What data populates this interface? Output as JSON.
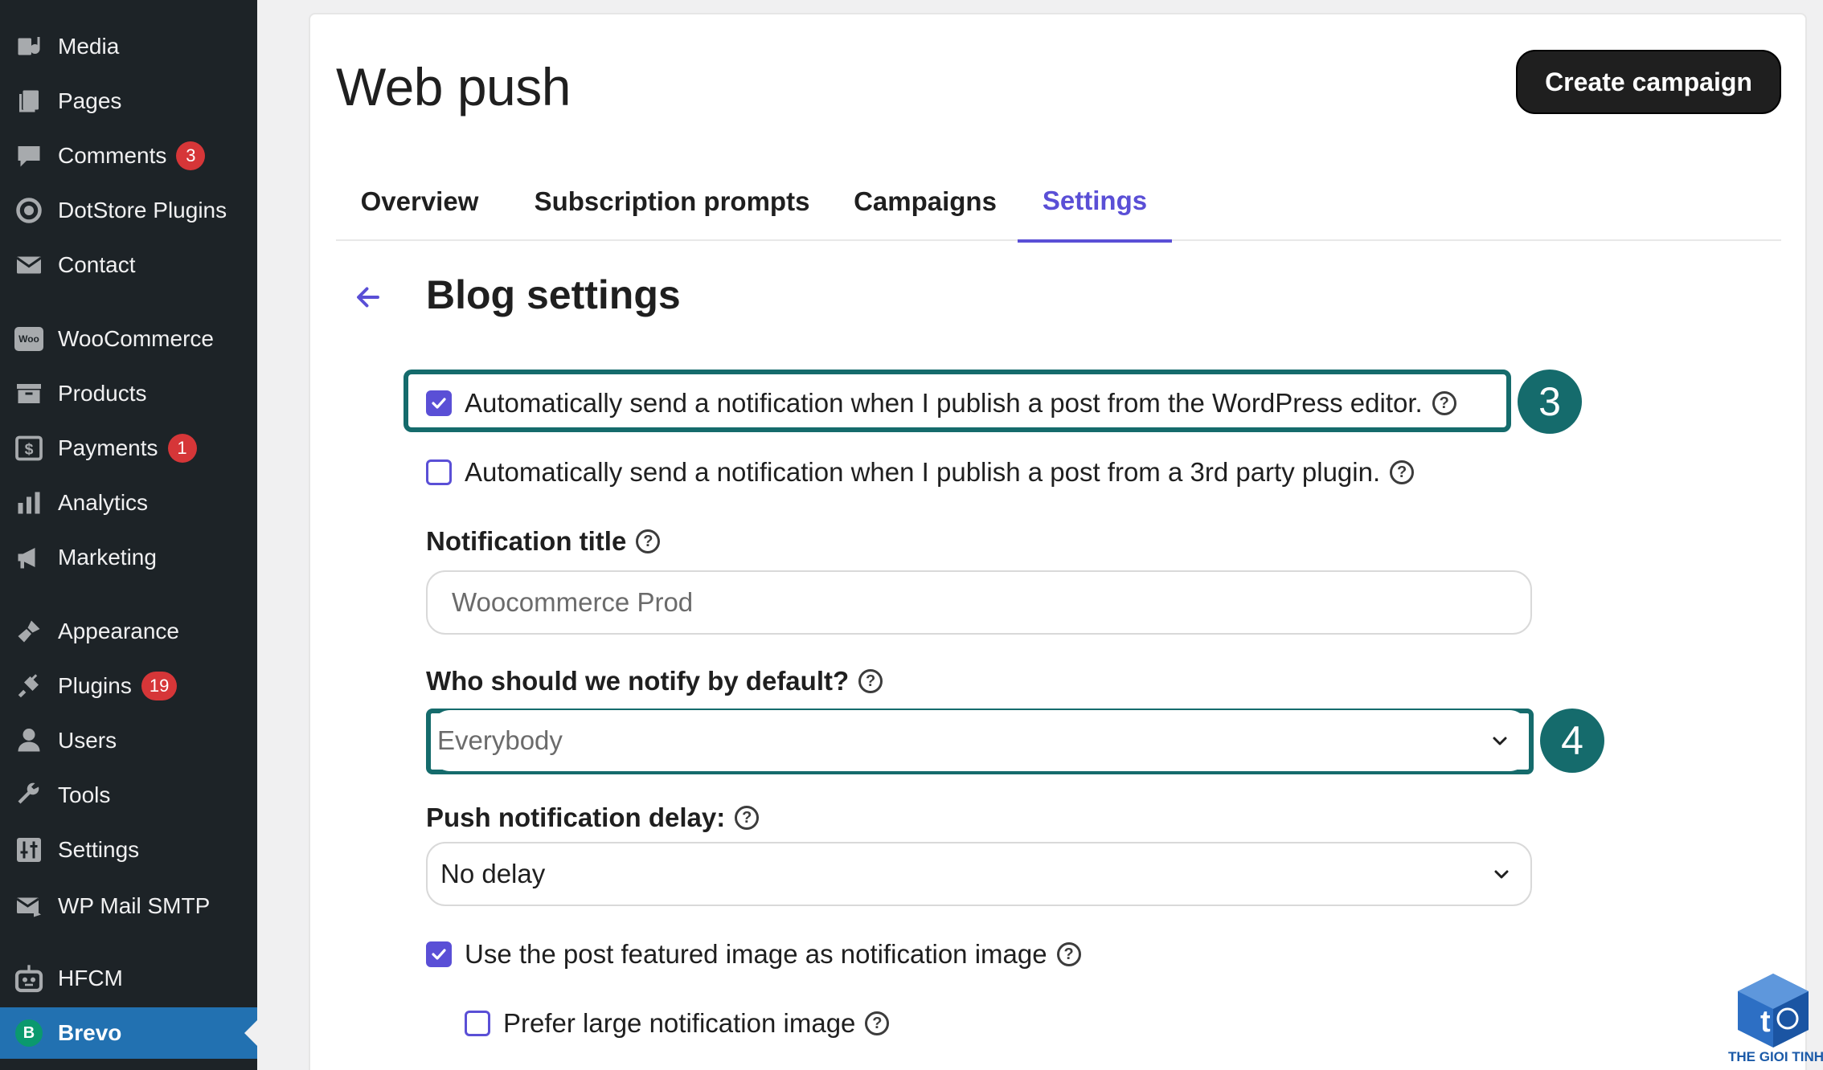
{
  "sidebar": {
    "items": [
      {
        "label": "Media",
        "icon": "media-icon"
      },
      {
        "label": "Pages",
        "icon": "pages-icon"
      },
      {
        "label": "Comments",
        "icon": "comments-icon",
        "badge": "3"
      },
      {
        "label": "DotStore Plugins",
        "icon": "dotstore-icon"
      },
      {
        "label": "Contact",
        "icon": "mail-icon"
      },
      {
        "label": "WooCommerce",
        "icon": "woocommerce-icon",
        "icon_text": "Woo"
      },
      {
        "label": "Products",
        "icon": "products-icon"
      },
      {
        "label": "Payments",
        "icon": "payments-icon",
        "badge": "1"
      },
      {
        "label": "Analytics",
        "icon": "analytics-icon"
      },
      {
        "label": "Marketing",
        "icon": "megaphone-icon"
      },
      {
        "label": "Appearance",
        "icon": "paintbrush-icon"
      },
      {
        "label": "Plugins",
        "icon": "plugin-icon",
        "badge": "19"
      },
      {
        "label": "Users",
        "icon": "users-icon"
      },
      {
        "label": "Tools",
        "icon": "wrench-icon"
      },
      {
        "label": "Settings",
        "icon": "settings-icon"
      },
      {
        "label": "WP Mail SMTP",
        "icon": "mail-smtp-icon"
      },
      {
        "label": "HFCM",
        "icon": "robot-icon"
      },
      {
        "label": "Brevo",
        "icon": "brevo-icon",
        "icon_text": "B",
        "active": true
      }
    ]
  },
  "header": {
    "title": "Web push",
    "create_button": "Create campaign"
  },
  "tabs": [
    {
      "label": "Overview"
    },
    {
      "label": "Subscription prompts"
    },
    {
      "label": "Campaigns"
    },
    {
      "label": "Settings",
      "active": true
    }
  ],
  "section": {
    "title": "Blog settings"
  },
  "options": {
    "auto_send_editor": {
      "label": "Automatically send a notification when I publish a post from the WordPress editor.",
      "checked": true,
      "step": "3"
    },
    "auto_send_plugin": {
      "label": "Automatically send a notification when I publish a post from a 3rd party plugin.",
      "checked": false
    },
    "notification_title": {
      "label": "Notification title",
      "value": "Woocommerce Prod"
    },
    "notify_default": {
      "label": "Who should we notify by default?",
      "value": "Everybody",
      "step": "4"
    },
    "delay": {
      "label": "Push notification delay:",
      "value": "No delay"
    },
    "featured_image": {
      "label": "Use the post featured image as notification image",
      "checked": true
    },
    "large_image": {
      "label": "Prefer large notification image",
      "checked": false
    }
  },
  "help_glyph": "?",
  "watermark": {
    "text": "THE GIOI TINHOC"
  },
  "colors": {
    "sidebar_bg": "#1d2327",
    "active_menu": "#2271b1",
    "accent": "#5a4fd6",
    "highlight": "#156b6c",
    "badge": "#d63638",
    "button_bg": "#1f1f1f"
  }
}
